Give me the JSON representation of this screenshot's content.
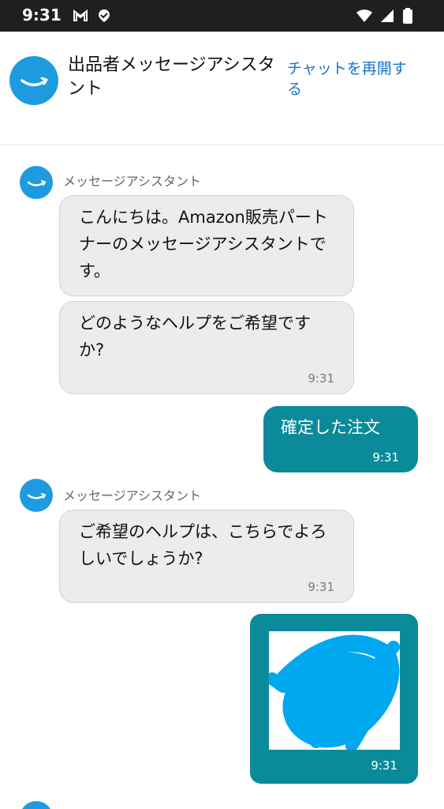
{
  "status_bar": {
    "time": "9:31",
    "left_icons": [
      "gmail-icon",
      "location-icon"
    ],
    "right_icons": [
      "wifi-icon",
      "signal-icon",
      "battery-icon"
    ]
  },
  "header": {
    "title": "出品者メッセージアシスタント",
    "restart_label": "チャットを再開する",
    "logo_icon": "amazon-smile-logo-icon"
  },
  "chat": {
    "assistant_name": "メッセージアシスタント",
    "messages": [
      {
        "from": "assistant",
        "text": "こんにちは。Amazon販売パートナーのメッセージアシスタントです。"
      },
      {
        "from": "assistant",
        "text": "どのようなヘルプをご希望ですか?",
        "time": "9:31"
      },
      {
        "from": "user",
        "text": "確定した注文",
        "time": "9:31"
      },
      {
        "from": "assistant",
        "text": "ご希望のヘルプは、こちらでよろしいでしょうか?",
        "time": "9:31"
      },
      {
        "from": "user",
        "type": "image",
        "time": "9:31"
      }
    ]
  },
  "colors": {
    "status_bar": "#1f1f1f",
    "accent_blue": "#1e9be0",
    "link_blue": "#1a73c8",
    "user_bubble": "#0b8a9a",
    "assistant_bubble": "#ececec",
    "scribble": "#00a8f0"
  }
}
